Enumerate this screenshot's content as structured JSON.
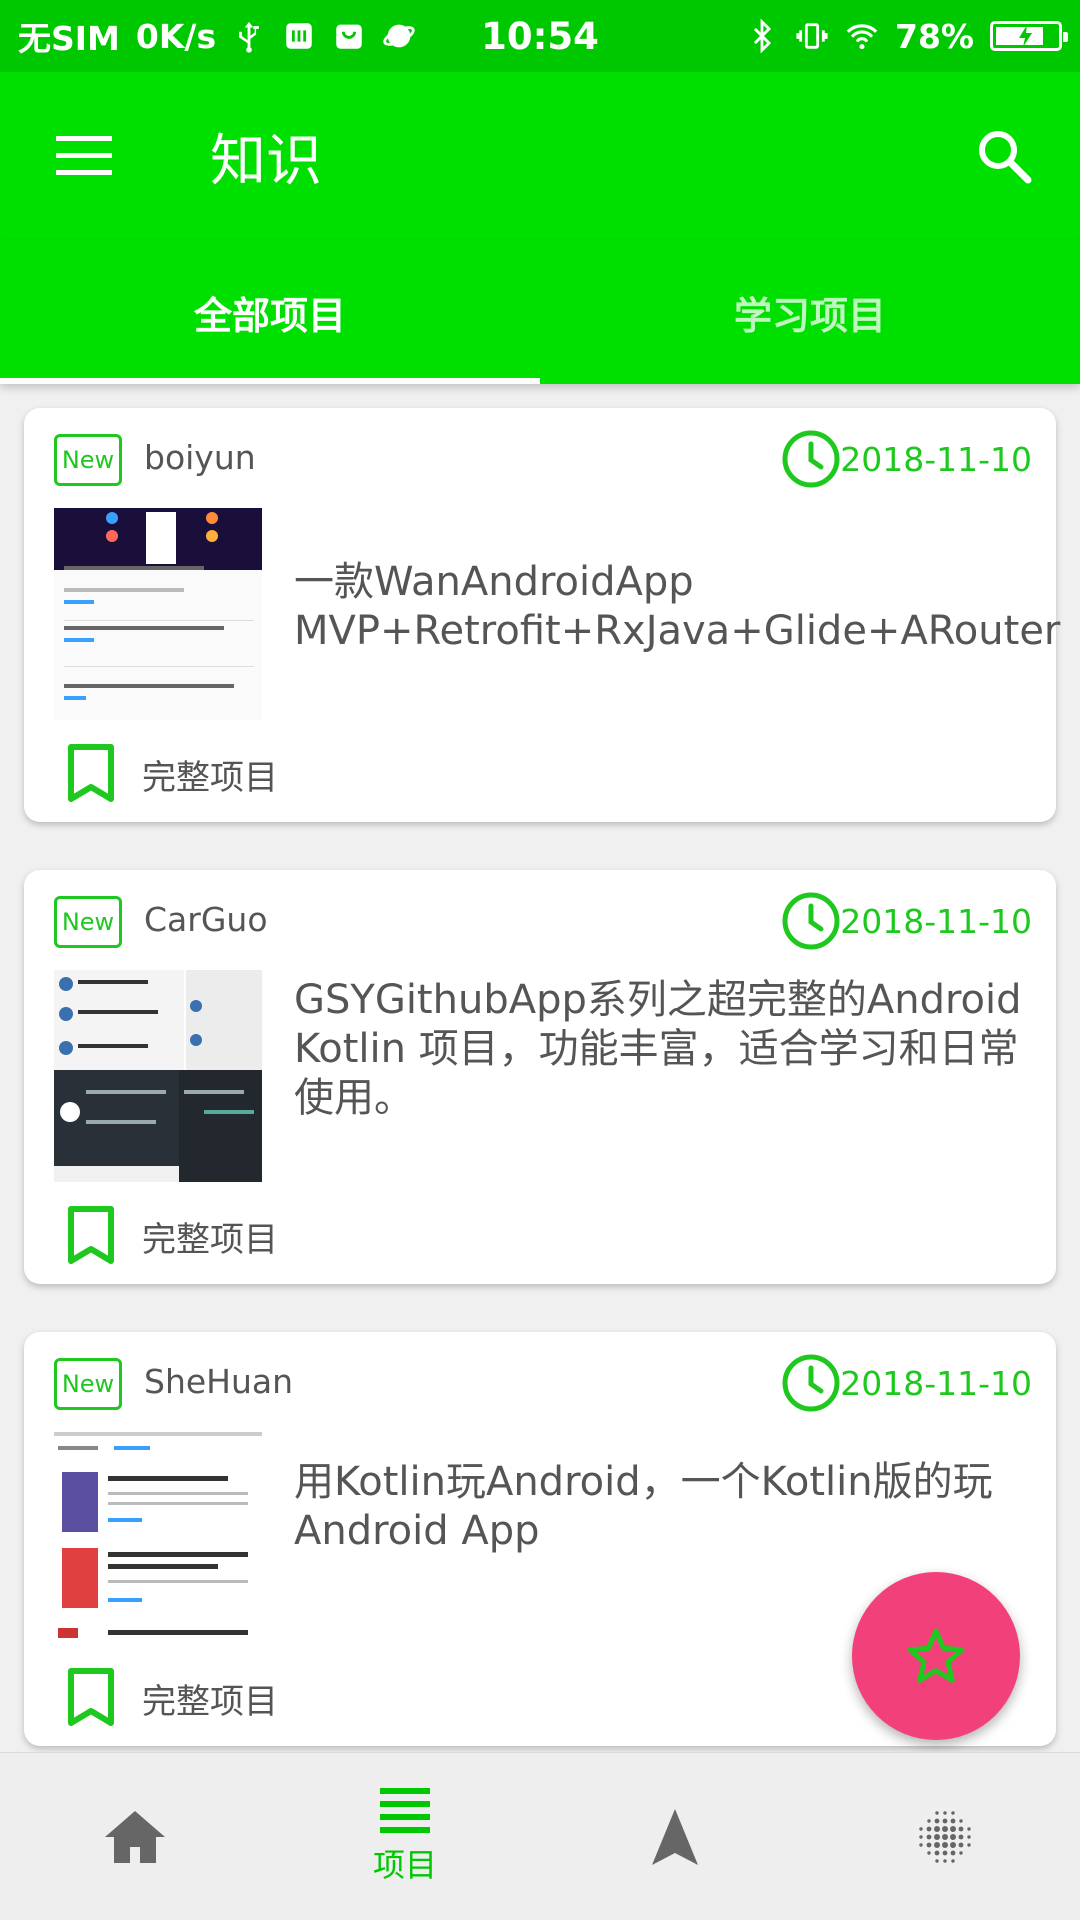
{
  "status_bar": {
    "carrier": "无SIM",
    "speed": "0K/s",
    "time": "10:54",
    "battery": "78%",
    "battery_level": 0.78
  },
  "app_bar": {
    "title": "知识",
    "menu_icon": "menu-icon",
    "search_icon": "search-icon"
  },
  "tabs": [
    {
      "label": "全部项目",
      "active": true
    },
    {
      "label": "学习项目",
      "active": false
    }
  ],
  "projects": [
    {
      "badge": "New",
      "author": "boiyun",
      "date": "2018-11-10",
      "title": "一款WanAndroidApp MVP+Retrofit+RxJava+Glide+ARouter",
      "tag": "完整项目"
    },
    {
      "badge": "New",
      "author": "CarGuo",
      "date": "2018-11-10",
      "title": "GSYGithubApp系列之超完整的Android Kotlin 项目，功能丰富，适合学习和日常使用。",
      "tag": "完整项目"
    },
    {
      "badge": "New",
      "author": "SheHuan",
      "date": "2018-11-10",
      "title": "用Kotlin玩Android，一个Kotlin版的玩Android App",
      "tag": "完整项目"
    }
  ],
  "fab_icon": "star-icon",
  "bottom_nav": [
    {
      "icon": "home-icon",
      "label": ""
    },
    {
      "icon": "list-icon",
      "label": "项目",
      "active": true
    },
    {
      "icon": "navigation-icon",
      "label": ""
    },
    {
      "icon": "dots-grid-icon",
      "label": ""
    }
  ],
  "colors": {
    "primary": "#00e000",
    "status_bar": "#00c800",
    "accent_green": "#1ec81e",
    "fab": "#f2417a",
    "text_gray": "#555555"
  }
}
